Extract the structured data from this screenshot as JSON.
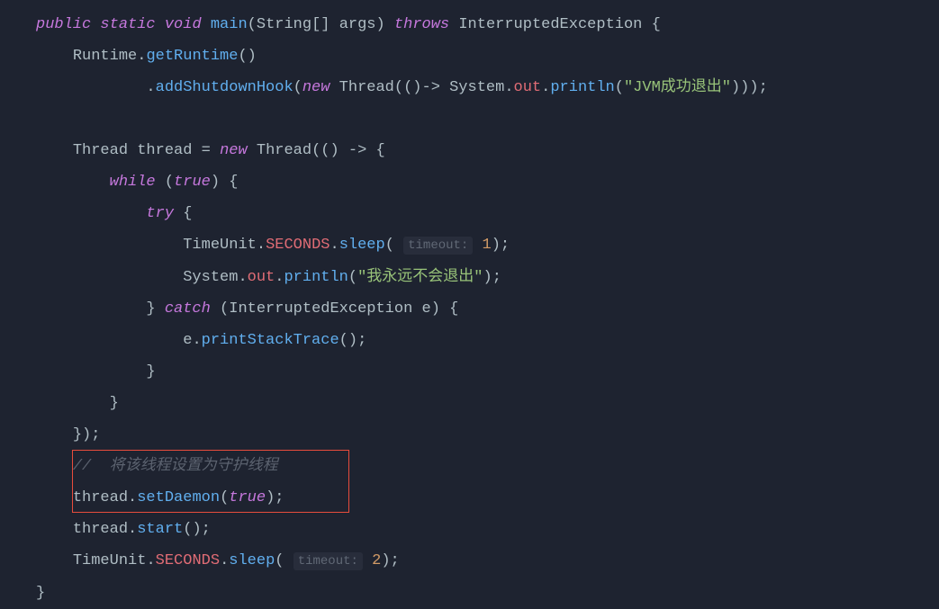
{
  "tokens": {
    "public": "public",
    "static": "static",
    "void": "void",
    "main": "main",
    "String": "String",
    "args": "args",
    "throws": "throws",
    "InterruptedException": "InterruptedException",
    "Runtime": "Runtime",
    "getRuntime": "getRuntime",
    "addShutdownHook": "addShutdownHook",
    "new": "new",
    "Thread": "Thread",
    "System": "System",
    "out": "out",
    "println": "println",
    "str_jvm_exit": "\"JVM成功退出\"",
    "thread_var": "thread",
    "while": "while",
    "true": "true",
    "try": "try",
    "TimeUnit": "TimeUnit",
    "SECONDS": "SECONDS",
    "sleep": "sleep",
    "hint_timeout": "timeout:",
    "num_1": "1",
    "str_never_exit": "\"我永远不会退出\"",
    "catch": "catch",
    "e_var": "e",
    "printStackTrace": "printStackTrace",
    "comment_daemon": "//  将该线程设置为守护线程",
    "setDaemon": "setDaemon",
    "start": "start",
    "num_2": "2"
  }
}
